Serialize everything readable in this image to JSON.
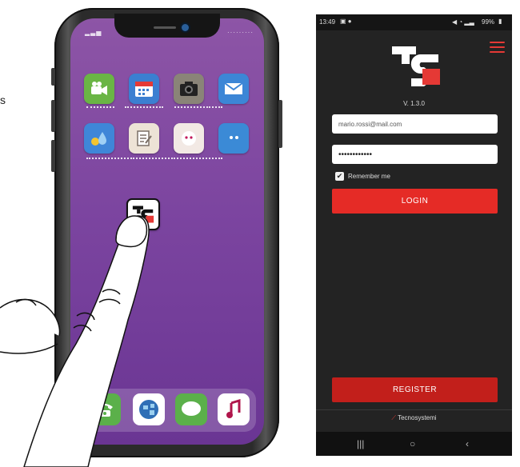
{
  "left_phone": {
    "status_time": "",
    "home_apps": [
      {
        "name": "video-camera-icon",
        "bg": "#6ab545"
      },
      {
        "name": "calendar-icon",
        "bg": "#3b7fd1"
      },
      {
        "name": "camera-icon",
        "bg": "#8a8478"
      },
      {
        "name": "mail-icon",
        "bg": "#3c86d6"
      },
      {
        "name": "weather-icon",
        "bg": "#3f86d8"
      },
      {
        "name": "notes-icon",
        "bg": "#ede3d6"
      },
      {
        "name": "chat-face-icon",
        "bg": "#f2e9e4"
      },
      {
        "name": "face-icon",
        "bg": "#3b8ad6"
      }
    ],
    "tapped_app": {
      "name": "tecnosystemi-app-icon"
    },
    "dock_apps": [
      {
        "name": "phone-icon",
        "bg": "#5bb04a"
      },
      {
        "name": "globe-icon",
        "bg": "#ffffff"
      },
      {
        "name": "messages-icon",
        "bg": "#5bb04a"
      },
      {
        "name": "music-icon",
        "bg": "#ffffff"
      }
    ]
  },
  "right_phone": {
    "status_time": "13:49",
    "status_right": "99%",
    "version": "V. 1.3.0",
    "email_value": "mario.rossi@mail.com",
    "password_value": "••••••••••••",
    "remember_label": "Remember me",
    "login_label": "LOGIN",
    "register_label": "REGISTER",
    "footer_brand": "Tecnosystemi",
    "accent_color": "#e52b26"
  },
  "edge_text": "s"
}
